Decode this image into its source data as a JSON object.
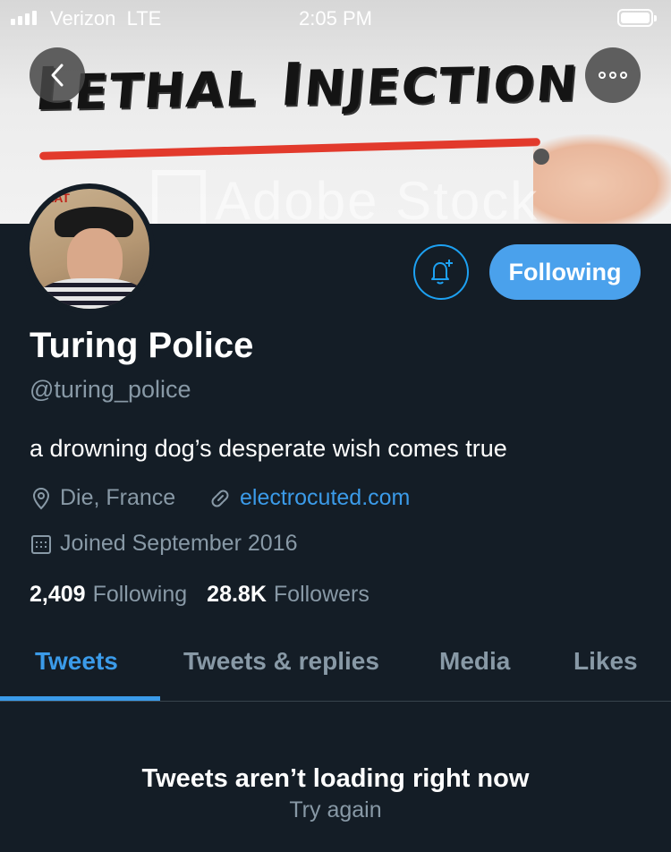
{
  "status_bar": {
    "carrier": "Verizon",
    "network": "LTE",
    "time": "2:05 PM"
  },
  "banner": {
    "title_big": "L",
    "title_rest": "ETHAL",
    "title_big2": "I",
    "title_rest2": "NJECTION",
    "watermark": "Adobe Stock",
    "accent_color": "#e23a2c"
  },
  "nav": {
    "back_icon": "chevron-left-icon",
    "more_icon": "more-horizontal-icon"
  },
  "profile": {
    "name": "Turing Police",
    "handle": "@turing_police",
    "bio": "a drowning dog’s desperate wish comes true",
    "location": "Die, France",
    "website": "electrocuted.com",
    "joined": "Joined September 2016",
    "avatar_text": "EAT",
    "following_count": "2,409",
    "following_label": "Following",
    "followers_count": "28.8K",
    "followers_label": "Followers"
  },
  "actions": {
    "follow_label": "Following",
    "bell_icon": "bell-plus-icon",
    "accent_color": "#4aa1ec"
  },
  "tabs": [
    {
      "label": "Tweets",
      "active": true
    },
    {
      "label": "Tweets & replies",
      "active": false
    },
    {
      "label": "Media",
      "active": false
    },
    {
      "label": "Likes",
      "active": false
    }
  ],
  "feed": {
    "message": "Tweets aren’t loading right now",
    "retry_label": "Try again"
  }
}
